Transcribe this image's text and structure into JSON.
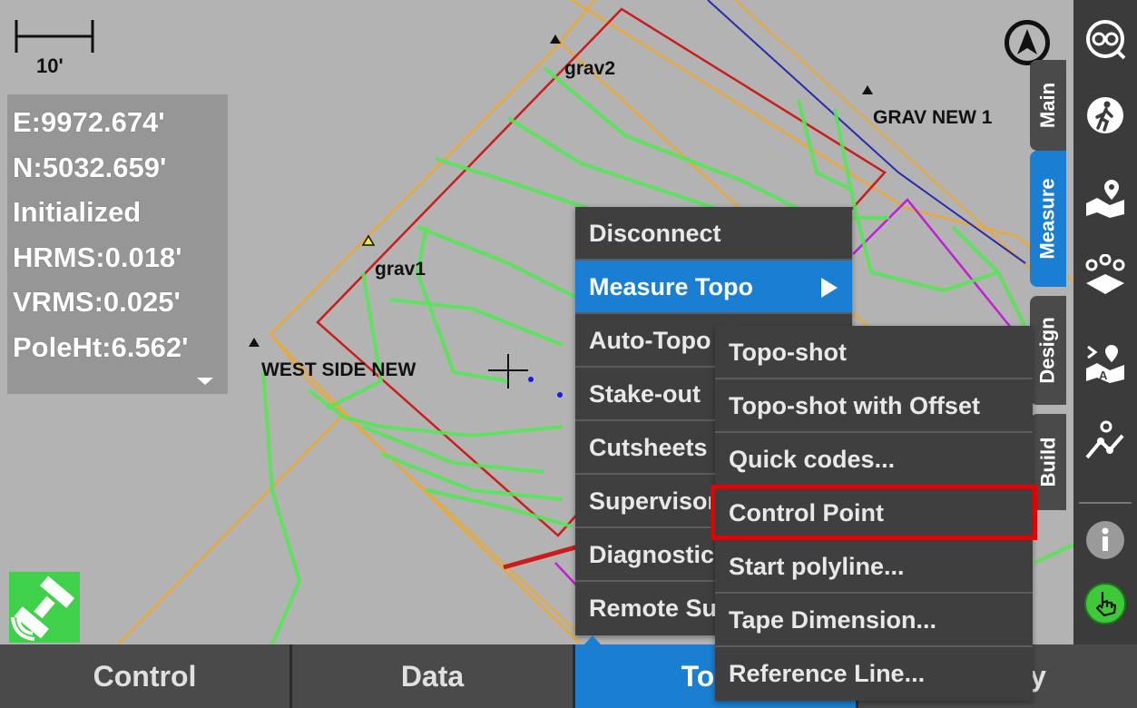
{
  "map": {
    "scale_label": "10'",
    "point_labels": {
      "grav2": "grav2",
      "grav_new_1": "GRAV NEW 1",
      "grav1": "grav1",
      "west_side_new": "WEST SIDE NEW"
    }
  },
  "status": {
    "easting": "E:9972.674'",
    "northing": "N:5032.659'",
    "state": "Initialized",
    "hrms": "HRMS:0.018'",
    "vrms": "VRMS:0.025'",
    "pole_height": "PoleHt:6.562'"
  },
  "side_tabs": {
    "main": "Main",
    "measure": "Measure",
    "design": "Design",
    "build": "Build"
  },
  "toolbar_icons": [
    "binoculars-icon",
    "hiker-icon",
    "map-pin-icon",
    "points-icon",
    "map-text-icon",
    "route-icon",
    "info-icon",
    "hand-icon"
  ],
  "measure_menu": {
    "items": [
      "Disconnect",
      "Measure Topo",
      "Auto-Topo",
      "Stake-out",
      "Cutsheets",
      "Supervisor",
      "Diagnostics",
      "Remote Support"
    ],
    "active_index": 1
  },
  "submenu": {
    "items": [
      "Topo-shot",
      "Topo-shot with Offset",
      "Quick codes...",
      "Control Point",
      "Start polyline...",
      "Tape Dimension...",
      "Reference Line..."
    ],
    "highlighted": "Control Point"
  },
  "bottom_tabs": [
    "Control",
    "Data",
    "Topo",
    "Survey"
  ],
  "bottom_active": "Topo",
  "colors": {
    "accent": "#1a7fd2",
    "menu_bg": "#3f3f3f",
    "highlight": "#e40000",
    "line_green": "#55e655",
    "line_red": "#cc1b1b",
    "line_orange": "#e8a93a",
    "line_magenta": "#c21ed6",
    "line_blue": "#2a2ab0"
  }
}
